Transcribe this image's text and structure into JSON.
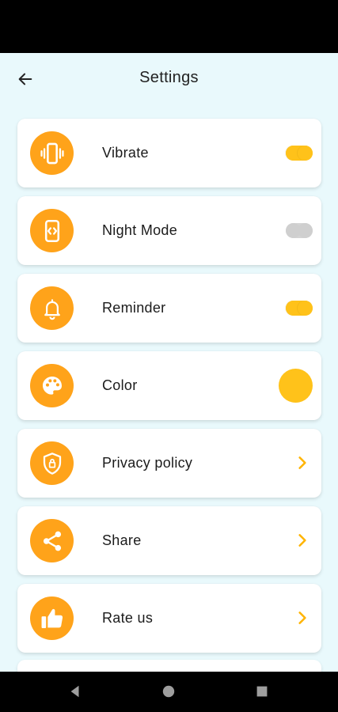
{
  "colors": {
    "accent": "#ffa31a",
    "toggle_on": "#ffc21a",
    "toggle_off": "#d4d4d4",
    "background": "#e9f9fc"
  },
  "header": {
    "title": "Settings",
    "back_icon": "arrow-left-icon"
  },
  "settings": [
    {
      "label": "Vibrate",
      "icon": "vibrate-phone-icon",
      "control": "toggle",
      "on": true
    },
    {
      "label": "Night Mode",
      "icon": "night-mode-phone-icon",
      "control": "toggle",
      "on": false
    },
    {
      "label": "Reminder",
      "icon": "bell-icon",
      "control": "toggle",
      "on": true
    },
    {
      "label": "Color",
      "icon": "palette-icon",
      "control": "color",
      "value": "#ffc21a"
    },
    {
      "label": "Privacy policy",
      "icon": "shield-icon",
      "control": "chevron"
    },
    {
      "label": "Share",
      "icon": "share-icon",
      "control": "chevron"
    },
    {
      "label": "Rate us",
      "icon": "thumbs-up-icon",
      "control": "chevron"
    }
  ],
  "nav": {
    "back": "nav-back-icon",
    "home": "nav-home-icon",
    "recents": "nav-recents-icon"
  }
}
